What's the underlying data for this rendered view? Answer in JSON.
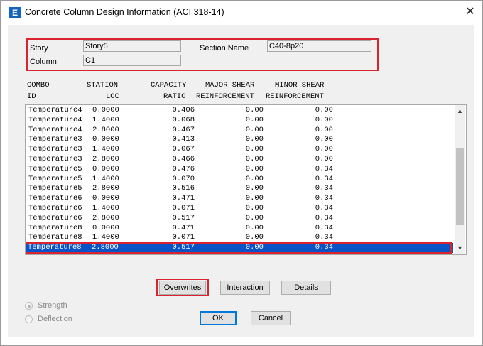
{
  "window": {
    "title": "Concrete Column Design Information (ACI 318-14)",
    "app_icon_letter": "E",
    "close_glyph": "✕"
  },
  "info": {
    "story_label": "Story",
    "story_value": "Story5",
    "column_label": "Column",
    "column_value": "C1",
    "section_label": "Section Name",
    "section_value": "C40-8p20"
  },
  "table": {
    "headers_line1": [
      "COMBO",
      "STATION",
      "CAPACITY",
      "MAJOR SHEAR",
      "MINOR SHEAR"
    ],
    "headers_line2": [
      "ID",
      "LOC",
      "RATIO",
      "REINFORCEMENT",
      "REINFORCEMENT"
    ],
    "rows": [
      [
        "Temperature4",
        "0.0000",
        "0.406",
        "0.00",
        "0.00"
      ],
      [
        "Temperature4",
        "1.4000",
        "0.068",
        "0.00",
        "0.00"
      ],
      [
        "Temperature4",
        "2.8000",
        "0.467",
        "0.00",
        "0.00"
      ],
      [
        "Temperature3",
        "0.0000",
        "0.413",
        "0.00",
        "0.00"
      ],
      [
        "Temperature3",
        "1.4000",
        "0.067",
        "0.00",
        "0.00"
      ],
      [
        "Temperature3",
        "2.8000",
        "0.466",
        "0.00",
        "0.00"
      ],
      [
        "Temperature5",
        "0.0000",
        "0.476",
        "0.00",
        "0.34"
      ],
      [
        "Temperature5",
        "1.4000",
        "0.070",
        "0.00",
        "0.34"
      ],
      [
        "Temperature5",
        "2.8000",
        "0.516",
        "0.00",
        "0.34"
      ],
      [
        "Temperature6",
        "0.0000",
        "0.471",
        "0.00",
        "0.34"
      ],
      [
        "Temperature6",
        "1.4000",
        "0.071",
        "0.00",
        "0.34"
      ],
      [
        "Temperature6",
        "2.8000",
        "0.517",
        "0.00",
        "0.34"
      ],
      [
        "Temperature8",
        "0.0000",
        "0.471",
        "0.00",
        "0.34"
      ],
      [
        "Temperature8",
        "1.4000",
        "0.071",
        "0.00",
        "0.34"
      ],
      [
        "Temperature8",
        "2.8000",
        "0.517",
        "0.00",
        "0.34"
      ]
    ],
    "selected_row": 14
  },
  "buttons": {
    "overwrites": "Overwrites",
    "interaction": "Interaction",
    "details": "Details",
    "ok": "OK",
    "cancel": "Cancel"
  },
  "options": {
    "strength": "Strength",
    "deflection": "Deflection",
    "selected": "strength"
  },
  "colors": {
    "highlight_red": "#d9232e",
    "selection_blue": "#0a52c8",
    "default_button_border": "#0078d7"
  }
}
